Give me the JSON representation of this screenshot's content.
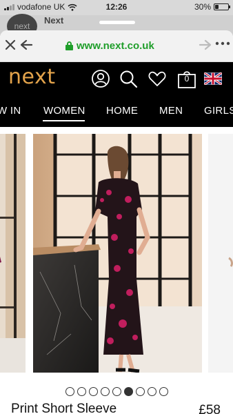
{
  "status_bar": {
    "carrier": "vodafone UK",
    "time": "12:26",
    "battery": "30%",
    "battery_level": 0.3,
    "wifi_icon": "wifi-icon"
  },
  "notification": {
    "avatar_text": "next",
    "title": "Next"
  },
  "browser": {
    "url": "www.next.co.uk",
    "close_icon": "close-icon",
    "back_icon": "back-arrow-icon",
    "forward_icon": "forward-arrow-icon",
    "more_icon": "more-icon"
  },
  "site": {
    "logo": "next",
    "basket_count": "0",
    "brand_color": "#e3a34b",
    "icons": [
      "account-icon",
      "search-icon",
      "favourites-icon",
      "basket-icon",
      "uk-flag-icon"
    ]
  },
  "categories": [
    {
      "label": "W IN",
      "active": false
    },
    {
      "label": "WOMEN",
      "active": true
    },
    {
      "label": "HOME",
      "active": false
    },
    {
      "label": "MEN",
      "active": false
    },
    {
      "label": "GIRLS",
      "active": false
    }
  ],
  "carousel": {
    "total_slides": 9,
    "active_index": 5
  },
  "product": {
    "title": "Print Short Sleeve",
    "price": "£58"
  }
}
